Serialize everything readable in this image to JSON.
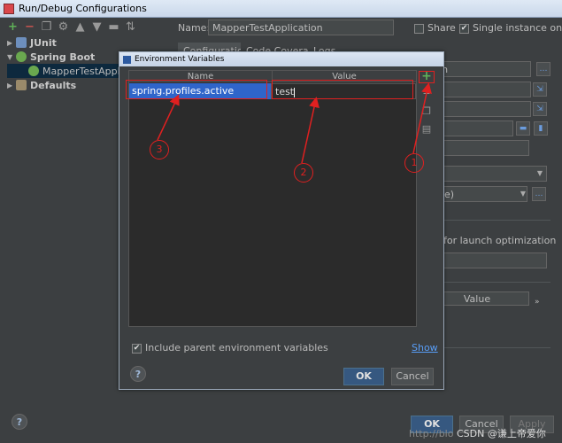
{
  "window": {
    "title": "Run/Debug Configurations"
  },
  "toolbar": {
    "add": "+",
    "remove": "−"
  },
  "tree": {
    "items": [
      {
        "label": "JUnit"
      },
      {
        "label": "Spring Boot"
      },
      {
        "label": "MapperTestApplic"
      },
      {
        "label": "Defaults"
      }
    ]
  },
  "config": {
    "name_label": "Name:",
    "name_value": "MapperTestApplication",
    "share_label": "Share",
    "single_instance_label": "Single instance only",
    "tabs": [
      "Configuration",
      "Code Coverage",
      "Logs"
    ],
    "partial_tion": "tion",
    "partial_dule": "dule)",
    "launch_opt": "for launch optimization",
    "value_header": "Value",
    "expand": "»"
  },
  "dialog": {
    "title": "Environment Variables",
    "columns": {
      "name": "Name",
      "value": "Value"
    },
    "row": {
      "name": "spring.profiles.active",
      "value": "test"
    },
    "include_parent": "Include parent environment variables",
    "show_link": "Show",
    "ok": "OK",
    "cancel": "Cancel",
    "help": "?"
  },
  "annotations": {
    "one": "1",
    "two": "2",
    "three": "3"
  },
  "footer": {
    "ok": "OK",
    "cancel": "Cancel",
    "apply": "Apply",
    "help": "?"
  },
  "watermark": {
    "url": "http://blo",
    "text": "CSDN @谦上帝爱你"
  },
  "colors": {
    "accent": "#365880",
    "selection": "#2f65ca",
    "annotation": "#e02020",
    "success": "#5fb158"
  }
}
